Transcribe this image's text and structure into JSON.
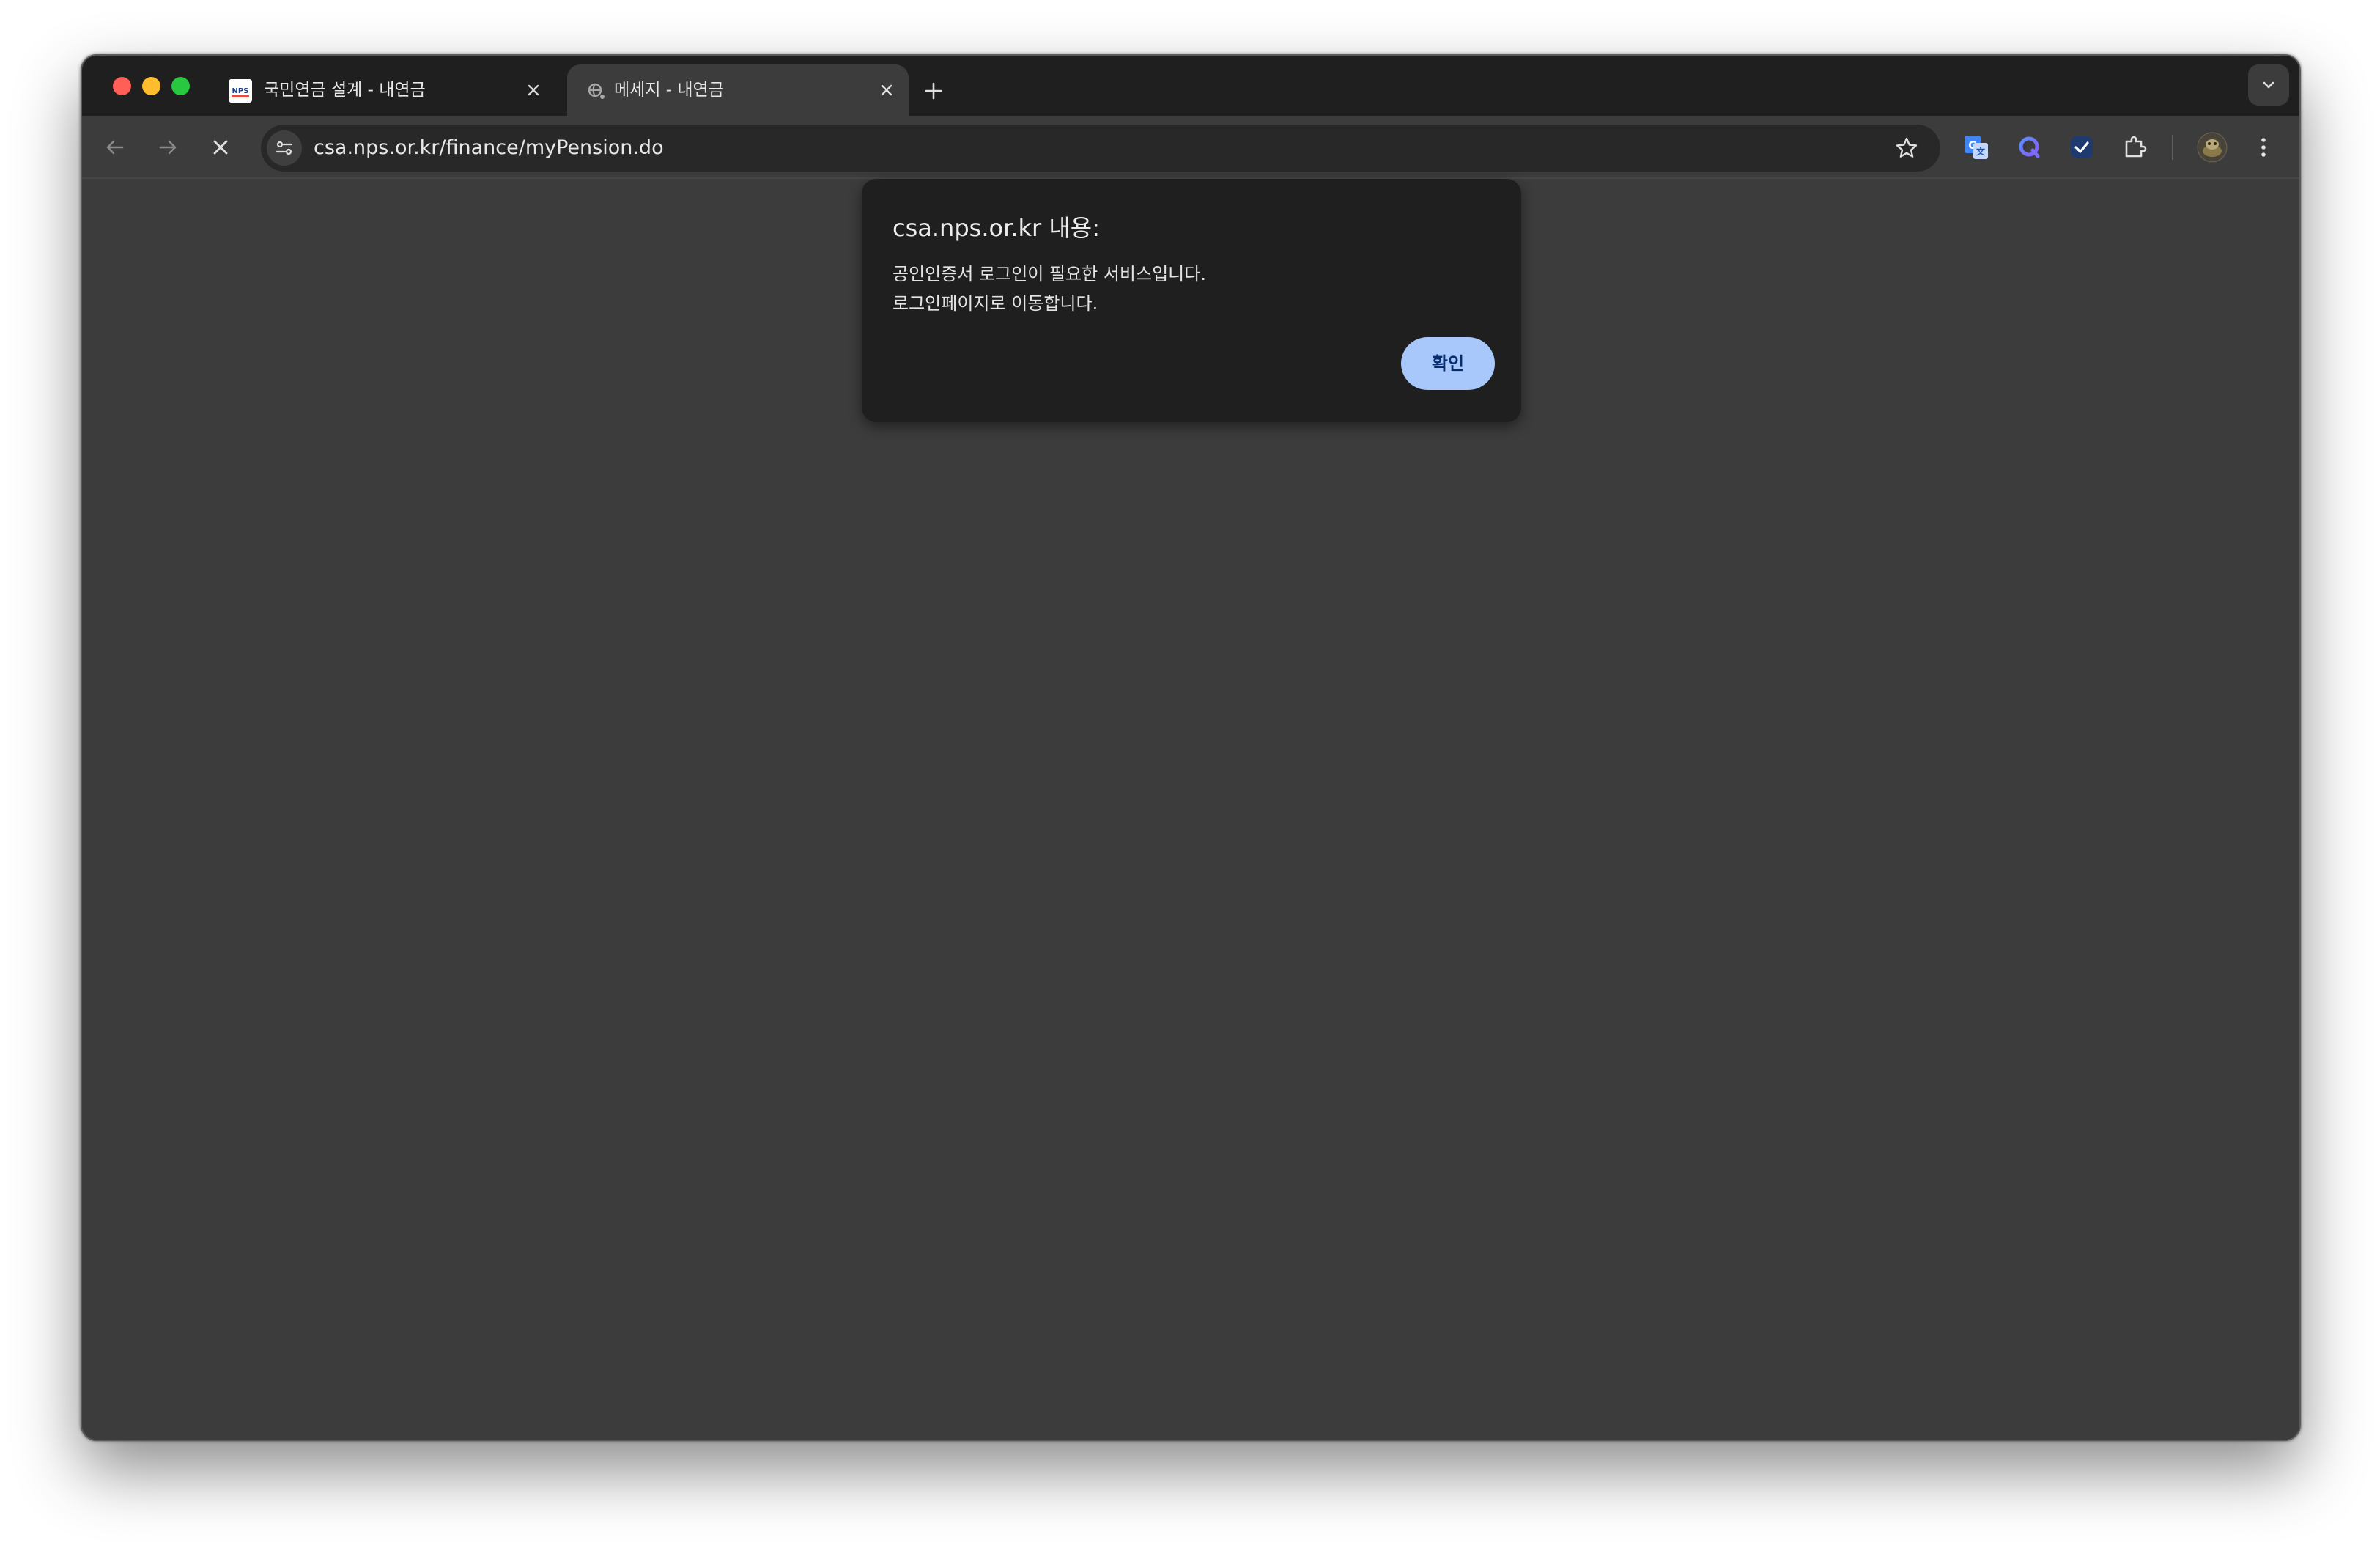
{
  "tabs": [
    {
      "title": "국민연금 설계 - 내연금",
      "active": false,
      "favicon": "nps-logo-icon"
    },
    {
      "title": "메세지 - 내연금",
      "active": true,
      "favicon": "loading-globe-icon"
    }
  ],
  "toolbar": {
    "url": "csa.nps.or.kr/finance/myPension.do"
  },
  "dialog": {
    "title": "csa.nps.or.kr 내용:",
    "message_line1": "공인인증서 로그인이 필요한 서비스입니다.",
    "message_line2": "로그인페이지로 이동합니다.",
    "ok_label": "확인"
  },
  "colors": {
    "tab_strip": "#1f1f1f",
    "toolbar": "#3c3c3c",
    "omnibox": "#282828",
    "dialog_bg": "#1f1f1f",
    "ok_button": "#a8c7fa",
    "ok_text": "#062e6f"
  }
}
